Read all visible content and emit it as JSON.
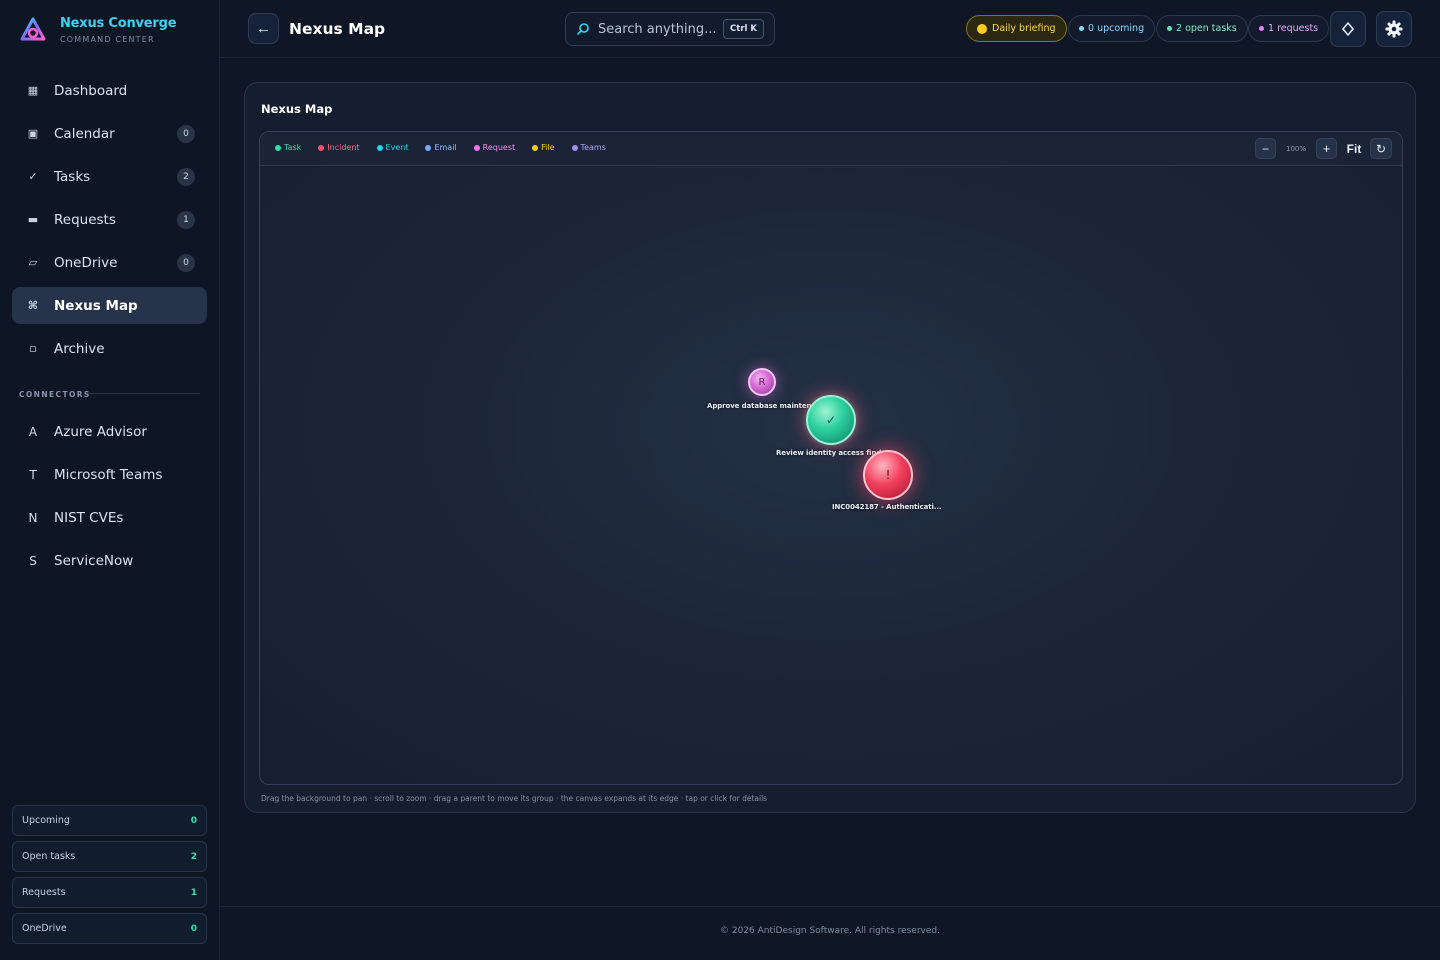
{
  "brand": {
    "name": "Nexus Converge",
    "subtitle": "COMMAND CENTER"
  },
  "nav": {
    "items": [
      {
        "icon": "grid-icon",
        "label": "Dashboard",
        "count": null,
        "active": false
      },
      {
        "icon": "calendar-icon",
        "label": "Calendar",
        "count": "0",
        "active": false
      },
      {
        "icon": "check-icon",
        "label": "Tasks",
        "count": "2",
        "active": false
      },
      {
        "icon": "inbox-icon",
        "label": "Requests",
        "count": "1",
        "active": false
      },
      {
        "icon": "cloud-folder-icon",
        "label": "OneDrive",
        "count": "0",
        "active": false
      },
      {
        "icon": "command-icon",
        "label": "Nexus Map",
        "count": null,
        "active": true
      },
      {
        "icon": "archive-icon",
        "label": "Archive",
        "count": null,
        "active": false
      }
    ]
  },
  "connectors": {
    "label": "CONNECTORS",
    "items": [
      {
        "letter": "A",
        "label": "Azure Advisor"
      },
      {
        "letter": "T",
        "label": "Microsoft Teams"
      },
      {
        "letter": "N",
        "label": "NIST CVEs"
      },
      {
        "letter": "S",
        "label": "ServiceNow"
      }
    ]
  },
  "summary": [
    {
      "label": "Upcoming",
      "value": "0"
    },
    {
      "label": "Open tasks",
      "value": "2"
    },
    {
      "label": "Requests",
      "value": "1"
    },
    {
      "label": "OneDrive",
      "value": "0"
    }
  ],
  "header": {
    "title": "Nexus Map",
    "search_placeholder": "Search anything...",
    "search_shortcut": "Ctrl K",
    "pills": {
      "briefing": "Daily briefing",
      "upcoming": "0 upcoming",
      "tasks": "2 open tasks",
      "requests": "1 requests"
    }
  },
  "panel": {
    "title": "Nexus Map",
    "legend": [
      {
        "label": "Task",
        "color": "#2fe0a8"
      },
      {
        "label": "Incident",
        "color": "#ff4d6d"
      },
      {
        "label": "Event",
        "color": "#22d3ee"
      },
      {
        "label": "Email",
        "color": "#7aa7ff"
      },
      {
        "label": "Request",
        "color": "#f472f0"
      },
      {
        "label": "File",
        "color": "#facc15"
      },
      {
        "label": "Teams",
        "color": "#a78bfa"
      }
    ],
    "zoom": {
      "minus": "−",
      "level": "100%",
      "plus": "+",
      "fit": "Fit",
      "reset": "↻"
    },
    "nodes": {
      "request": {
        "glyph": "R",
        "label": "Approve database maintenan..."
      },
      "task": {
        "glyph": "✓",
        "label": "Review identity access find..."
      },
      "incident": {
        "glyph": "!",
        "label": "INC0042187 - Authenticati..."
      }
    },
    "hint": "Drag the background to pan · scroll to zoom · drag a parent to move its group · the canvas expands at its edge · tap or click for details"
  },
  "footer": "© 2026 AntiDesign Software. All rights reserved."
}
